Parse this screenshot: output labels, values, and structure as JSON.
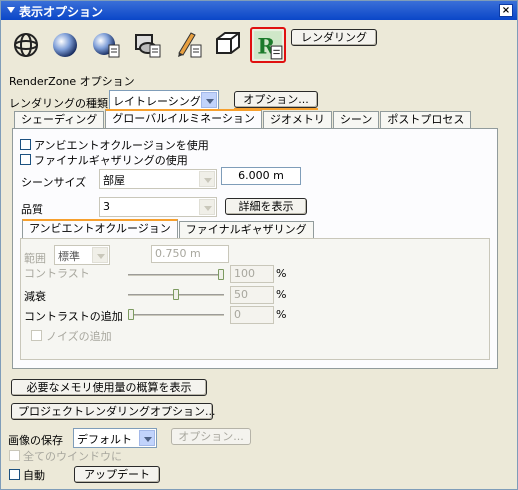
{
  "window": {
    "title": "表示オプション",
    "close_glyph": "×"
  },
  "toolbar": {
    "icons": [
      "wireframe-sphere-icon",
      "shaded-sphere-icon",
      "shaded-sphere-doc-icon",
      "render-objects-icon",
      "pencil-doc-icon",
      "box-icon",
      "renderzone-icon"
    ],
    "render_button": "レンダリング"
  },
  "section_title": "RenderZone オプション",
  "render_type": {
    "label": "レンダリングの種類",
    "value": "レイトレーシング",
    "options_button": "オプション..."
  },
  "tabs": [
    "シェーディング",
    "グローバルイルミネーション",
    "ジオメトリ",
    "シーン",
    "ポストプロセス"
  ],
  "gi": {
    "ambient_occlusion_check": "アンビエントオクルージョンを使用",
    "final_gathering_check": "ファイナルギャザリングの使用",
    "scene_size": {
      "label": "シーンサイズ",
      "value": "部屋",
      "field": "6.000 m"
    },
    "quality": {
      "label": "品質",
      "value": "3",
      "details_button": "詳細を表示"
    },
    "subtabs": [
      "アンビエントオクルージョン",
      "ファイナルギャザリング"
    ],
    "range": {
      "label": "範囲",
      "mode": "標準",
      "value": "0.750 m"
    },
    "contrast": {
      "label": "コントラスト",
      "value": "100",
      "unit": "%",
      "level": 1.0
    },
    "attenuation": {
      "label": "減衰",
      "value": "50",
      "unit": "%",
      "level": 0.5
    },
    "contrast_add": {
      "label": "コントラストの追加",
      "value": "0",
      "unit": "%",
      "level": 0.0
    },
    "noise_check": "ノイズの追加"
  },
  "memory_button": "必要なメモリ使用量の概算を表示",
  "project_button": "プロジェクトレンダリングオプション...",
  "save_image": {
    "label": "画像の保存",
    "value": "デフォルト",
    "options_button": "オプション..."
  },
  "all_windows_check": "全てのウインドウに",
  "auto_check": "自動",
  "update_button": "アップデート",
  "colors": {
    "titlebar": "#0a46c8",
    "selected_icon_border": "#e01010",
    "active_tab_accent": "#f7a02d"
  }
}
